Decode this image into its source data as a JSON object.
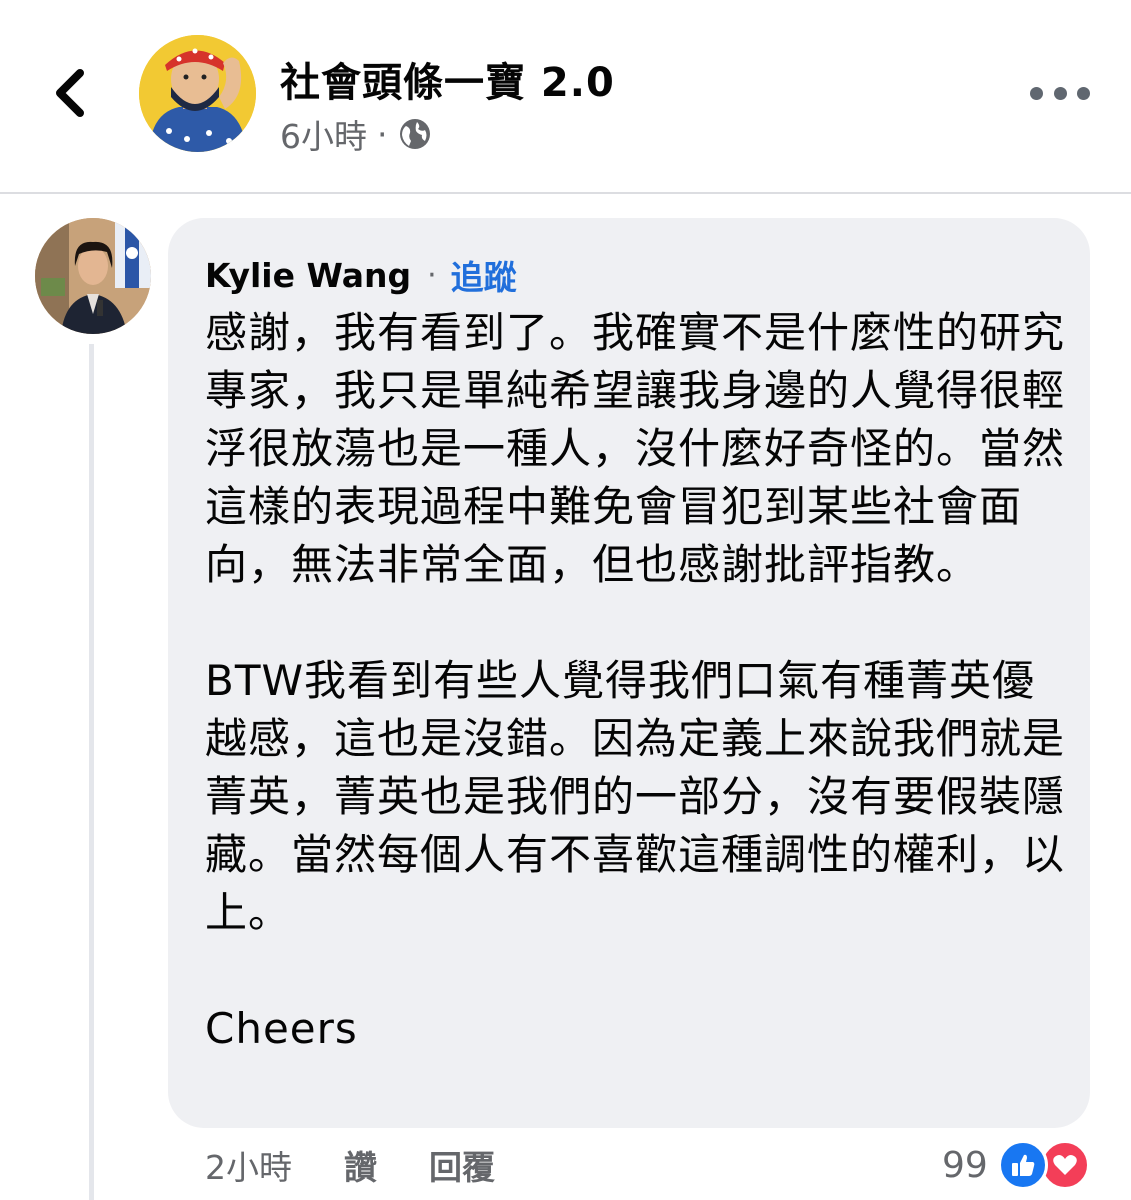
{
  "header": {
    "page_name": "社會頭條一寶 2.0",
    "post_time": "6小時",
    "separator": "·",
    "audience_icon": "globe-icon",
    "back_icon": "chevron-left-icon",
    "more_icon": "ellipsis-icon"
  },
  "comment": {
    "author": "Kylie Wang",
    "separator": "·",
    "follow_label": "追蹤",
    "text": "感謝，我有看到了。我確實不是什麼性的研究專家，我只是單純希望讓我身邊的人覺得很輕浮很放蕩也是一種人，沒什麼好奇怪的。當然這樣的表現過程中難免會冒犯到某些社會面向，無法非常全面，但也感謝批評指教。\n\nBTW我看到有些人覺得我們口氣有種菁英優越感，這也是沒錯。因為定義上來說我們就是菁英，菁英也是我們的一部分，沒有要假裝隱藏。當然每個人有不喜歡這種調性的權利，以上。\n\nCheers",
    "time": "2小時",
    "like_label": "讚",
    "reply_label": "回覆",
    "reaction_count": "99",
    "reaction_icons": [
      "thumbs-up-icon",
      "heart-icon"
    ]
  },
  "colors": {
    "bubble": "#eff0f3",
    "secondary_text": "#65676b",
    "link": "#216fdb",
    "like_blue": "#1877f2",
    "love_red": "#f33e58"
  }
}
